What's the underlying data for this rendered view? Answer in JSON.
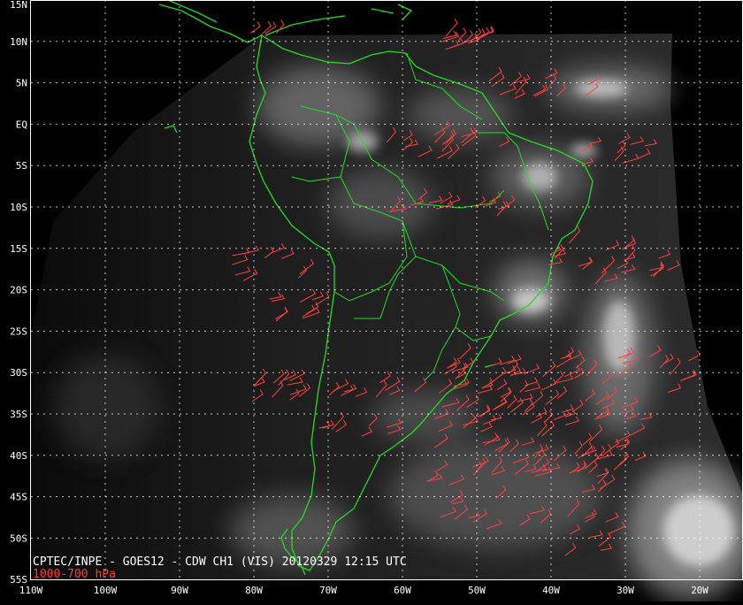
{
  "map": {
    "caption": "CPTEC/INPE - GOES12 - CDW CH1 (VIS) 20120329 12:15 UTC",
    "level_caption": "1000-700 hPa",
    "latitude_labels": [
      "15N",
      "10N",
      "5N",
      "EQ",
      "5S",
      "10S",
      "15S",
      "20S",
      "25S",
      "30S",
      "35S",
      "40S",
      "45S",
      "50S",
      "55S"
    ],
    "longitude_labels": [
      "110W",
      "100W",
      "90W",
      "80W",
      "70W",
      "60W",
      "50W",
      "40W",
      "30W",
      "20W"
    ],
    "colors": {
      "background": "#000000",
      "coastline": "#22dd22",
      "wind_barbs": "#ff4040",
      "grid": "#ffffff",
      "caption": "#ffffff",
      "level_caption": "#ff3b3b"
    }
  }
}
